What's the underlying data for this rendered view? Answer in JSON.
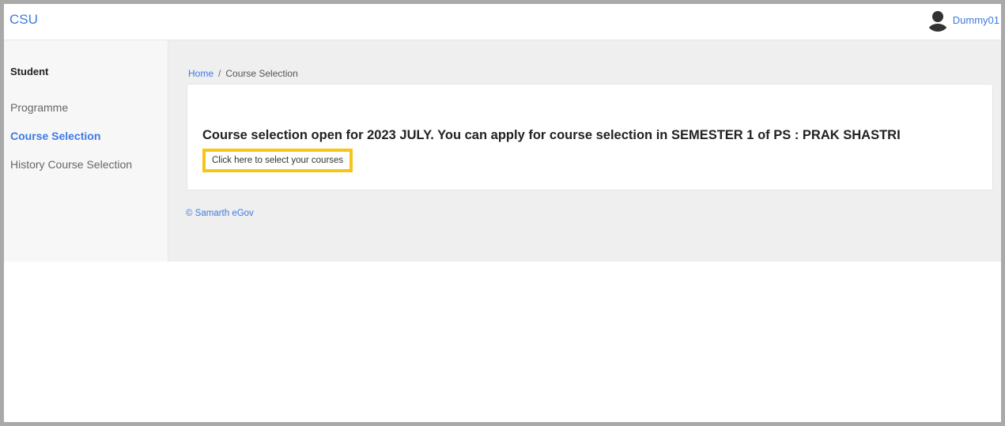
{
  "header": {
    "brand": "CSU",
    "user_name": "Dummy01",
    "avatar_icon": "user-avatar-icon"
  },
  "sidebar": {
    "heading": "Student",
    "items": [
      {
        "label": "Programme",
        "active": false
      },
      {
        "label": "Course Selection",
        "active": true
      },
      {
        "label": "History Course Selection",
        "active": false
      }
    ]
  },
  "breadcrumb": {
    "home": "Home",
    "separator": "/",
    "current": "Course Selection"
  },
  "main": {
    "notice": "Course selection open for 2023 JULY. You can apply for course selection in SEMESTER 1 of PS : PRAK SHASTRI",
    "select_button": "Click here to select your courses"
  },
  "footer": {
    "copyright": "© Samarth eGov"
  },
  "colors": {
    "accent": "#3c7ae4",
    "highlight": "#f5c518"
  }
}
